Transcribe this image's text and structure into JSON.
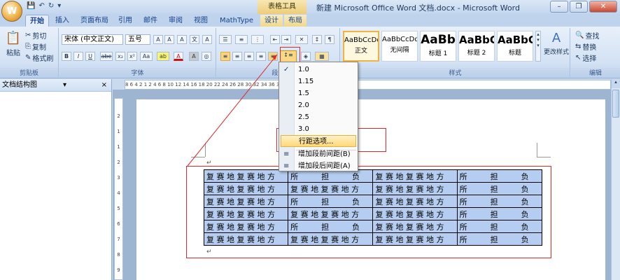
{
  "window": {
    "title": "新建 Microsoft Office Word 文档.docx - Microsoft Word",
    "context_tab_title": "表格工具",
    "buttons": {
      "minimize": "–",
      "restore": "❐",
      "close": "✕"
    }
  },
  "qat": {
    "save": "💾",
    "undo": "↶",
    "redo": "↻",
    "more": "▾"
  },
  "office_button": {
    "label": "W"
  },
  "tabs": [
    "开始",
    "插入",
    "页面布局",
    "引用",
    "邮件",
    "审阅",
    "视图",
    "MathType",
    "设计",
    "布局"
  ],
  "clipboard": {
    "group_label": "剪贴板",
    "paste": "粘贴",
    "cut": "剪切",
    "copy": "复制",
    "format_painter": "格式刷"
  },
  "font": {
    "group_label": "字体",
    "font_name": "宋体 (中文正文)",
    "font_size": "五号",
    "grow": "A",
    "shrink": "A",
    "clear": "A",
    "phonetic": "文",
    "border": "A",
    "bold": "B",
    "italic": "I",
    "underline": "U",
    "strike": "abe",
    "subscript": "x₂",
    "superscript": "x²",
    "case": "Aa",
    "highlight": "ab",
    "color": "A",
    "shading": "A"
  },
  "paragraph": {
    "group_label": "段落"
  },
  "styles": {
    "group_label": "样式",
    "change_styles": "更改样式",
    "items": [
      {
        "sample": "AaBbCcDd",
        "name": "正文"
      },
      {
        "sample": "AaBbCcDd",
        "name": "无间隔"
      },
      {
        "sample": "AaBb",
        "name": "标题 1"
      },
      {
        "sample": "AaBbC",
        "name": "标题 2"
      },
      {
        "sample": "AaBbC",
        "name": "标题"
      }
    ]
  },
  "editing": {
    "group_label": "编辑",
    "find": "查找",
    "replace": "替换",
    "select": "选择"
  },
  "docmap": {
    "title": "文档结构图",
    "close": "×"
  },
  "hruler": "8  6  4  2  1  2  4  6  8  10  12  14  16  18  20  22  24  26  28  30  32  34  36  38  40  42  44  46  48",
  "vruler": [
    "2",
    "1",
    "1",
    "2",
    "3",
    "4",
    "5",
    "6",
    "7",
    "8",
    "9"
  ],
  "line_spacing_menu": {
    "options": [
      "1.0",
      "1.15",
      "1.5",
      "2.0",
      "2.5",
      "3.0"
    ],
    "checked_option": "1.0",
    "line_spacing_options": "行距选项...",
    "add_space_before": "增加段前间距(B)",
    "add_space_after": "增加段后间距(A)"
  },
  "table": {
    "rows": [
      [
        "复 赛 地 复 赛 地 方",
        "所　　　担　　　负",
        "复 赛 地 复 赛 地 方",
        "所　　　担　　　负"
      ],
      [
        "复 赛 地 复 赛 地 方",
        "复 赛 地 复 赛 地 方",
        "复 赛 地 复 赛 地 方",
        "所　　　担　　　负"
      ],
      [
        "复 赛 地 复 赛 地 方",
        "所　　　担　　　负",
        "复 赛 地 复 赛 地 方",
        "所　　　担　　　负"
      ],
      [
        "复 赛 地 复 赛 地 方",
        "复 赛 地 复 赛 地 方",
        "复 赛 地 复 赛 地 方",
        "所　　　担　　　负"
      ],
      [
        "复 赛 地 复 赛 地 方",
        "所　　　担　　　负",
        "复 赛 地 复 赛 地 方",
        "所　　　担　　　负"
      ],
      [
        "复 赛 地 复 赛 地 方",
        "复 赛 地 复 赛 地 方",
        "复 赛 地 复 赛 地 方",
        "所　　　担　　　负"
      ]
    ],
    "paragraph_mark": "↵"
  }
}
